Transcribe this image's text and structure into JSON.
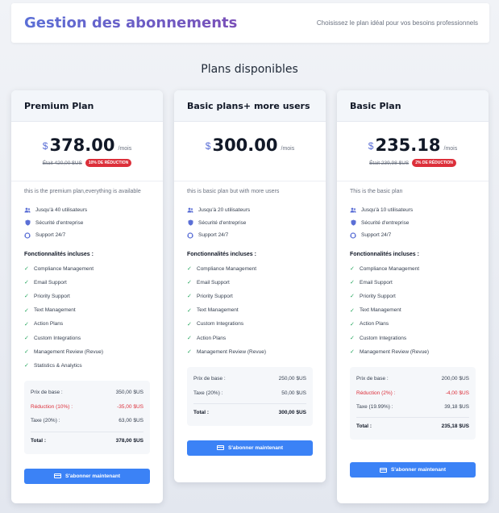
{
  "header": {
    "title": "Gestion des abonnements",
    "subtitle": "Choisissez le plan idéal pour vos besoins professionnels"
  },
  "section_title": "Plans disponibles",
  "colors": {
    "accent": "#5b6fd6",
    "cta": "#3b82f6",
    "badge": "#dc2f3a",
    "check": "#22a55a"
  },
  "plans": [
    {
      "name": "Premium Plan",
      "currency": "$",
      "price": "378.00",
      "per": "/mois",
      "old_price": "Était 420,00 $US",
      "badge": "10% DE RÉDUCTION",
      "description": "this is the premium plan,everything is available",
      "meta": [
        {
          "icon": "users-icon",
          "text": "Jusqu'à 40 utilisateurs"
        },
        {
          "icon": "shield-icon",
          "text": "Sécurité d'entreprise"
        },
        {
          "icon": "support-icon",
          "text": "Support 24/7"
        }
      ],
      "features_title": "Fonctionnalités incluses :",
      "features": [
        "Compliance Management",
        "Email Support",
        "Priority Support",
        "Text Management",
        "Action Plans",
        "Custom Integrations",
        "Management Review (Revue)",
        "Statistics & Analytics"
      ],
      "totals": [
        {
          "label": "Prix de base :",
          "value": "350,00 $US",
          "style": ""
        },
        {
          "label": "Réduction (10%) :",
          "value": "-35,00 $US",
          "style": "red"
        },
        {
          "label": "Taxe (20%) :",
          "value": "63,00 $US",
          "style": ""
        }
      ],
      "total_label": "Total :",
      "total_value": "378,00 $US",
      "cta": "S'abonner maintenant"
    },
    {
      "name": "Basic plans+ more users",
      "currency": "$",
      "price": "300.00",
      "per": "/mois",
      "old_price": "",
      "badge": "",
      "description": "this is basic plan but with more users",
      "meta": [
        {
          "icon": "users-icon",
          "text": "Jusqu'à 20 utilisateurs"
        },
        {
          "icon": "shield-icon",
          "text": "Sécurité d'entreprise"
        },
        {
          "icon": "support-icon",
          "text": "Support 24/7"
        }
      ],
      "features_title": "Fonctionnalités incluses :",
      "features": [
        "Compliance Management",
        "Email Support",
        "Priority Support",
        "Text Management",
        "Custom Integrations",
        "Action Plans",
        "Management Review (Revue)"
      ],
      "totals": [
        {
          "label": "Prix de base :",
          "value": "250,00 $US",
          "style": ""
        },
        {
          "label": "Taxe (20%) :",
          "value": "50,00 $US",
          "style": ""
        }
      ],
      "total_label": "Total :",
      "total_value": "300,00 $US",
      "cta": "S'abonner maintenant"
    },
    {
      "name": "Basic Plan",
      "currency": "$",
      "price": "235.18",
      "per": "/mois",
      "old_price": "Était 239,98 $US",
      "badge": "2% DE RÉDUCTION",
      "description": "This is the basic plan",
      "meta": [
        {
          "icon": "users-icon",
          "text": "Jusqu'à 10 utilisateurs"
        },
        {
          "icon": "shield-icon",
          "text": "Sécurité d'entreprise"
        },
        {
          "icon": "support-icon",
          "text": "Support 24/7"
        }
      ],
      "features_title": "Fonctionnalités incluses :",
      "features": [
        "Compliance Management",
        "Email Support",
        "Priority Support",
        "Text Management",
        "Action Plans",
        "Custom Integrations",
        "Management Review (Revue)"
      ],
      "totals": [
        {
          "label": "Prix de base :",
          "value": "200,00 $US",
          "style": ""
        },
        {
          "label": "Réduction (2%) :",
          "value": "-4,00 $US",
          "style": "red"
        },
        {
          "label": "Taxe (19.99%) :",
          "value": "39,18 $US",
          "style": ""
        }
      ],
      "total_label": "Total :",
      "total_value": "235,18 $US",
      "cta": "S'abonner maintenant"
    }
  ]
}
